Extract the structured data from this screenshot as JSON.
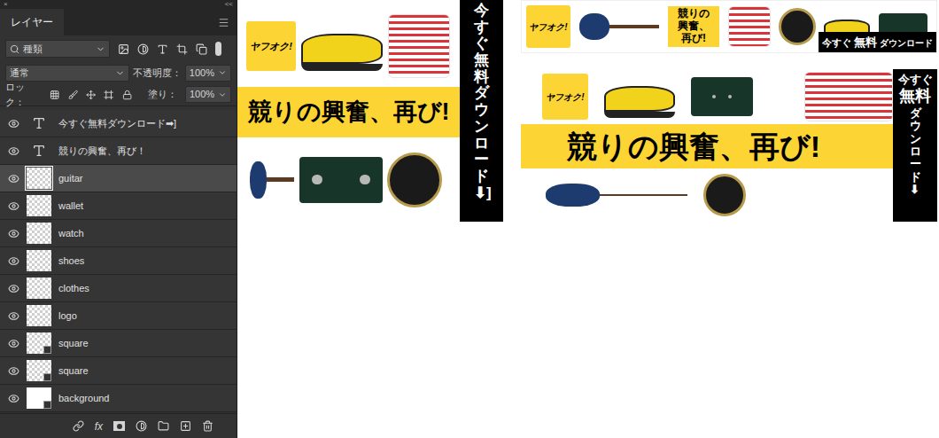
{
  "panel": {
    "close": "×",
    "collapse": "<<",
    "tab": "レイヤー",
    "filter": {
      "label": "種類"
    },
    "blend_mode": "通常",
    "opacity": {
      "label": "不透明度：",
      "value": "100%"
    },
    "lock": {
      "label": "ロック："
    },
    "fill": {
      "label": "塗り：",
      "value": "100%"
    },
    "layers": [
      {
        "name": "今すぐ無料ダウンロード➡]",
        "kind": "text",
        "visible": true,
        "selected": false
      },
      {
        "name": "競りの興奮、再び！",
        "kind": "text",
        "visible": true,
        "selected": false
      },
      {
        "name": "guitar",
        "kind": "pixel",
        "visible": true,
        "selected": true
      },
      {
        "name": "wallet",
        "kind": "pixel",
        "visible": true,
        "selected": false
      },
      {
        "name": "watch",
        "kind": "pixel",
        "visible": true,
        "selected": false
      },
      {
        "name": "shoes",
        "kind": "pixel",
        "visible": true,
        "selected": false
      },
      {
        "name": "clothes",
        "kind": "pixel",
        "visible": true,
        "selected": false
      },
      {
        "name": "logo",
        "kind": "pixel",
        "visible": true,
        "selected": false
      },
      {
        "name": "square",
        "kind": "shape",
        "visible": true,
        "selected": false
      },
      {
        "name": "square",
        "kind": "shape",
        "visible": true,
        "selected": false
      },
      {
        "name": "background",
        "kind": "fill",
        "visible": true,
        "selected": false
      }
    ],
    "footer": {
      "fx": "fx"
    }
  },
  "banners": {
    "rectangle": {
      "logo": "ヤフオク!",
      "headline": "競りの興奮、再び!",
      "cta": "今すぐ無料ダウンロード⬇]"
    },
    "leaderboard": {
      "logo": "ヤフオク!",
      "headline_lines": [
        "競りの",
        "興奮、",
        "再び!"
      ],
      "cta": {
        "lead": "今すぐ",
        "main": "無料",
        "tail": "ダウンロード"
      }
    },
    "wide": {
      "logo": "ヤフオク!",
      "headline": "競りの興奮、再び!",
      "cta": {
        "lead": "今すぐ",
        "main": "無料",
        "tail": "ダウンロード⬇"
      }
    }
  }
}
